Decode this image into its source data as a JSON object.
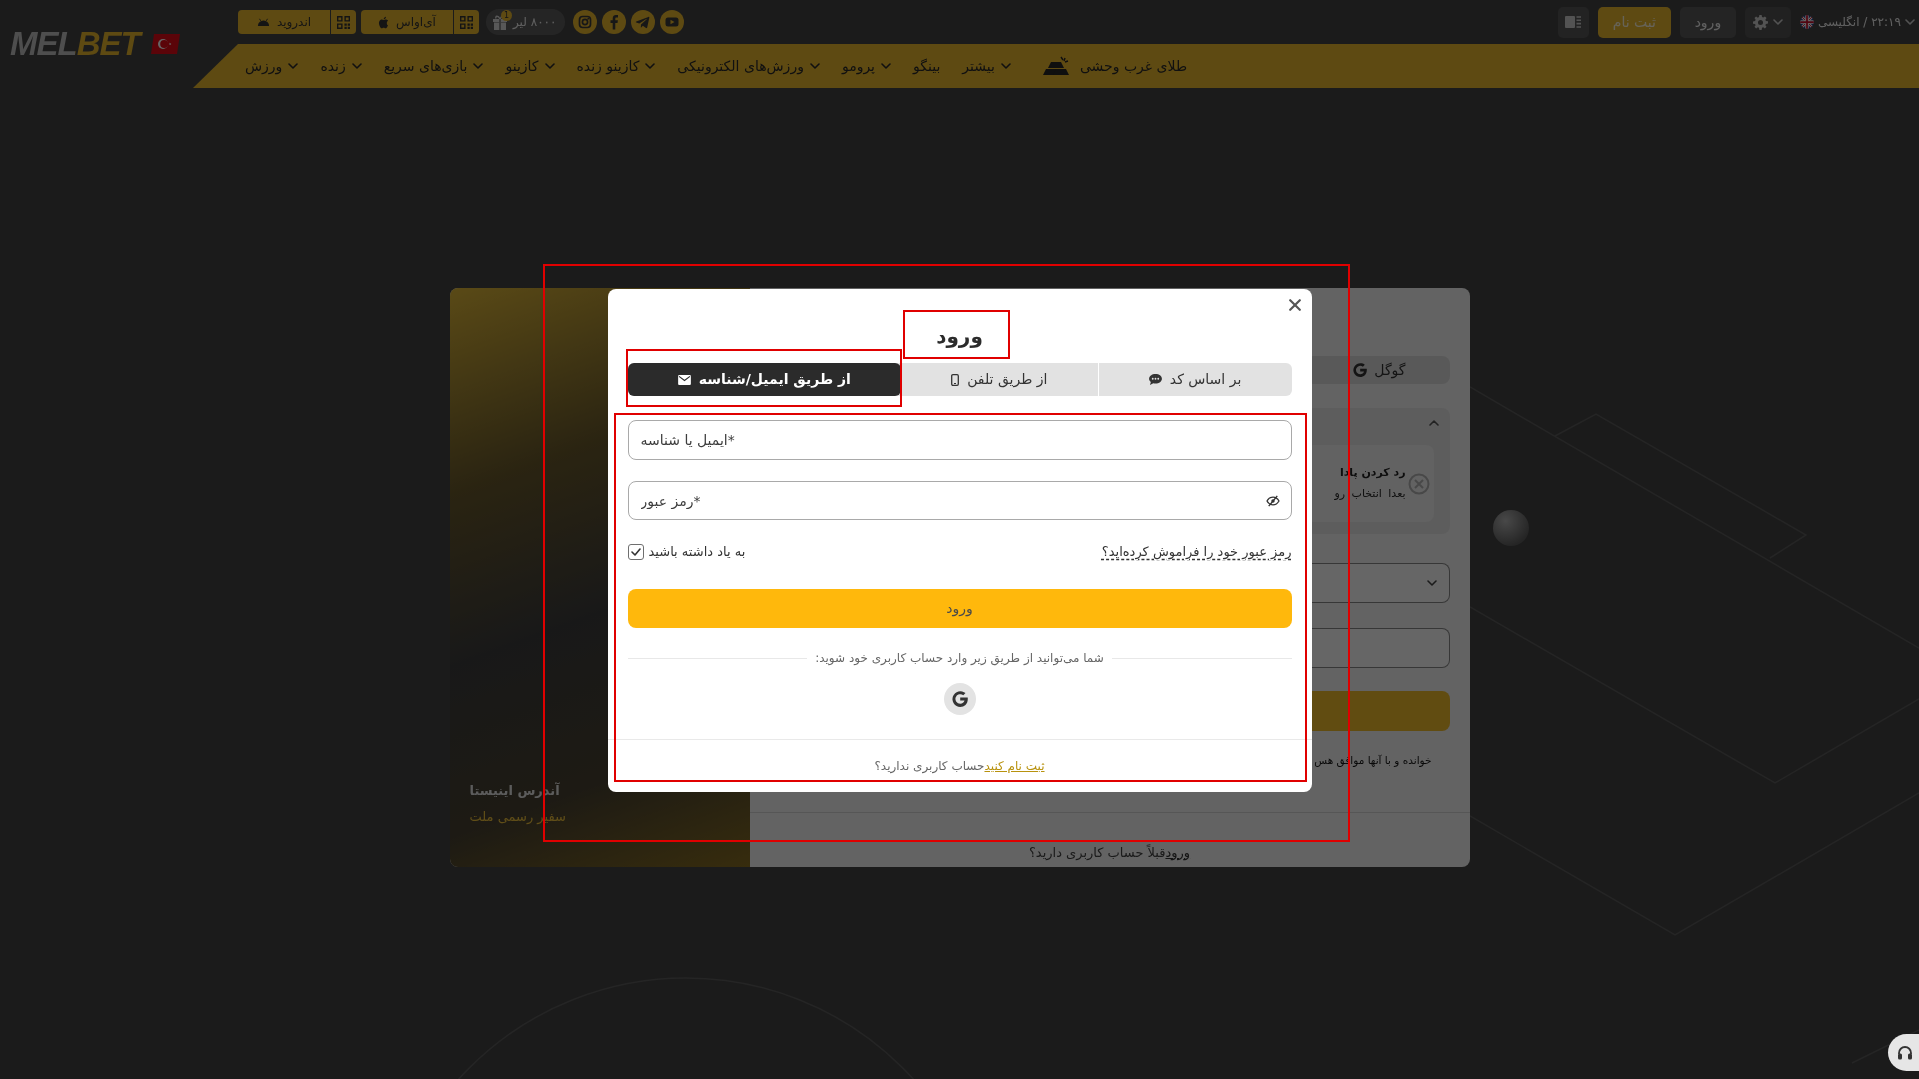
{
  "header": {
    "logo": "MELBET",
    "app_buttons": [
      {
        "label": "آی‌اواس"
      },
      {
        "label": "اندروید"
      }
    ],
    "bonus": {
      "amount": "۸۰۰۰ لیر",
      "badge": "1"
    },
    "register_button": "ثبت نام",
    "login_button": "ورود",
    "locale": "۲۲:۱۹ / انگلیسی"
  },
  "nav": [
    {
      "label": "طلای غرب وحشی",
      "kind": "featured"
    },
    {
      "label": "بیشتر",
      "kind": "menu"
    },
    {
      "label": "بینگو",
      "kind": "link"
    },
    {
      "label": "پرومو",
      "kind": "menu"
    },
    {
      "label": "ورزش‌های الکترونیکی",
      "kind": "menu"
    },
    {
      "label": "کازینو زنده",
      "kind": "menu"
    },
    {
      "label": "کازینو",
      "kind": "menu"
    },
    {
      "label": "بازی‌های سریع",
      "kind": "menu"
    },
    {
      "label": "زنده",
      "kind": "menu"
    },
    {
      "label": "ورزش",
      "kind": "menu"
    }
  ],
  "registration_card": {
    "photo_caption": {
      "name": "آندرس اینیستا",
      "role": "سفیر رسمی ملت"
    },
    "google_tab": "گوگل",
    "bonus_option": {
      "title": "رد کردن پادا",
      "subtitle": "بعدا انتخاب رو",
      "expanded": true
    },
    "terms_text": "خوانده و با آنها موافق هس",
    "login_prompt": {
      "text": "قبلاً حساب کاربری دارید؟",
      "link": "ورود"
    }
  },
  "login_modal": {
    "highlighted": true,
    "title": {
      "text": "ورود",
      "highlighted": true
    },
    "tabs": [
      {
        "label": "بر اساس کد",
        "selected": false,
        "highlighted": false
      },
      {
        "label": "از طریق تلفن",
        "selected": false,
        "highlighted": false
      },
      {
        "label": "از طریق ایمیل/شناسه",
        "selected": true,
        "highlighted": true
      }
    ],
    "form": {
      "highlighted": true,
      "login_field": {
        "placeholder": "ایمیل یا شناسه*"
      },
      "password_field": {
        "placeholder": "رمز عبور*"
      },
      "remember_me": {
        "label": "به یاد داشته باشید",
        "checked": true
      },
      "forgot_link": "رمز عبور خود را فراموش کرده‌اید؟",
      "submit": "ورود",
      "social_prompt": "شما می‌توانید از طریق زیر وارد حساب کاربری خود شوید:",
      "signup_prompt": {
        "text": "حساب کاربری ندارید؟",
        "link": "ثبت نام کنید"
      }
    }
  }
}
